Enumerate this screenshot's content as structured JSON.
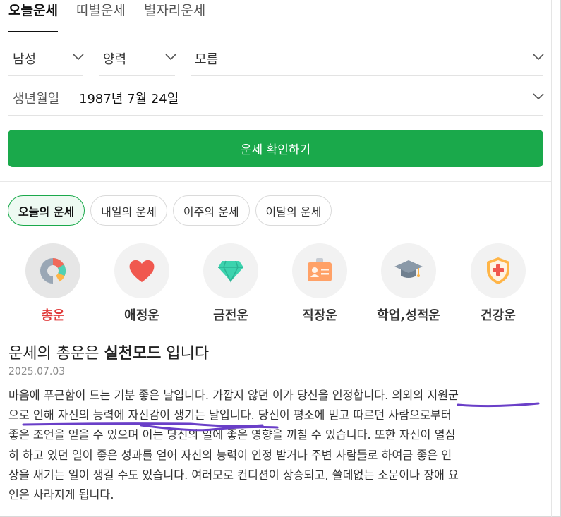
{
  "tabs": [
    "오늘운세",
    "띠별운세",
    "별자리운세"
  ],
  "selects": {
    "gender": "남성",
    "calendar": "양력",
    "time": "모름"
  },
  "birth": {
    "label": "생년월일",
    "value": "1987년 7월 24일"
  },
  "confirm_button": "운세 확인하기",
  "period_chips": [
    "오늘의 운세",
    "내일의 운세",
    "이주의 운세",
    "이달의 운세"
  ],
  "categories": [
    {
      "label": "총운",
      "icon": "donut-chart-icon"
    },
    {
      "label": "애정운",
      "icon": "heart-icon"
    },
    {
      "label": "금전운",
      "icon": "gem-icon"
    },
    {
      "label": "직장운",
      "icon": "id-card-icon"
    },
    {
      "label": "학업,성적운",
      "icon": "graduation-cap-icon"
    },
    {
      "label": "건강운",
      "icon": "health-shield-icon"
    }
  ],
  "article": {
    "title_prefix": "운세의 총운은 ",
    "title_bold": "실천모드",
    "title_suffix": " 입니다",
    "date": "2025.07.03",
    "lines": [
      "마음에 푸근함이 드는 기분 좋은 날입니다. 가깝지 않던 이가 당신을 인정합니다. 의외의 지원군",
      "으로 인해 자신의 능력에 자신감이 생기는 날입니다. 당신이 평소에 믿고 따르던 사람으로부터",
      "좋은 조언을 얻을 수 있으며 이는 당신의 일에 좋은 영향을 끼칠 수 있습니다. 또한 자신이 열심",
      "히 하고 있던 일이 좋은 성과를 얻어 자신의 능력이 인정 받거나 주변 사람들로 하여금 좋은 인",
      "상을 새기는 일이 생길 수도 있습니다. 여러모로 컨디션이 상승되고, 쓸데없는 소문이나 장애 요",
      "인은 사라지게 됩니다."
    ]
  },
  "colors": {
    "accent": "#1aa94b",
    "active_category": "#e03a3a",
    "annotation": "#6a3fc8"
  }
}
